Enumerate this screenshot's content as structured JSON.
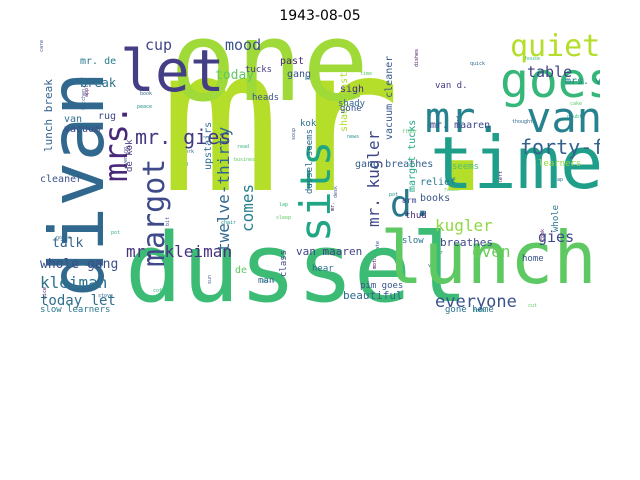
{
  "title": "1943-08-05",
  "words": [
    {
      "text": "mr.",
      "color": "#b5de2b"
    },
    {
      "text": "one",
      "color": "#a0da39"
    },
    {
      "text": "dussel",
      "color": "#3cbb75"
    },
    {
      "text": "lunch",
      "color": "#5ec962"
    },
    {
      "text": "time",
      "color": "#1f9e89"
    },
    {
      "text": "divan",
      "color": "#31688e"
    },
    {
      "text": "let",
      "color": "#433e85"
    },
    {
      "text": "goes",
      "color": "#35b779"
    },
    {
      "text": "mr. van",
      "color": "#26828e"
    },
    {
      "text": "quiet",
      "color": "#b5de2b"
    },
    {
      "text": "sits",
      "color": "#21a685"
    },
    {
      "text": "margot",
      "color": "#3e4a89"
    },
    {
      "text": "mrs.",
      "color": "#482878"
    },
    {
      "text": "d.",
      "color": "#2a788e"
    },
    {
      "text": "everyone",
      "color": "#3b528b"
    },
    {
      "text": "mr. gies",
      "color": "#443983"
    },
    {
      "text": "forty-five",
      "color": "#35608d"
    },
    {
      "text": "mr. kugler",
      "color": "#3f4788"
    },
    {
      "text": "mr. kleiman",
      "color": "#46327e"
    },
    {
      "text": "kleiman",
      "color": "#2c728e"
    },
    {
      "text": "even",
      "color": "#6ccd5a"
    },
    {
      "text": "comes",
      "color": "#277f8e"
    },
    {
      "text": "twelve-thirty",
      "color": "#31688e"
    },
    {
      "text": "kugler",
      "color": "#90d743"
    },
    {
      "text": "gies",
      "color": "#3e4989"
    },
    {
      "text": "table",
      "color": "#424086"
    },
    {
      "text": "mood",
      "color": "#3b528b"
    },
    {
      "text": "cup",
      "color": "#404688"
    },
    {
      "text": "today let",
      "color": "#2e6f8e"
    },
    {
      "text": "whole gang",
      "color": "#3d4e8a"
    },
    {
      "text": "talk",
      "color": "#33638d"
    },
    {
      "text": "today",
      "color": "#5ec962"
    },
    {
      "text": "break",
      "color": "#2c728e"
    },
    {
      "text": "van maaren",
      "color": "#414487"
    },
    {
      "text": "beautiful",
      "color": "#31688e"
    },
    {
      "text": "gang breathes",
      "color": "#355f8d"
    },
    {
      "text": "breathes",
      "color": "#3e4a89"
    },
    {
      "text": "relief",
      "color": "#2a788e"
    },
    {
      "text": "books",
      "color": "#3a548c"
    },
    {
      "text": "lunch break",
      "color": "#33638d"
    },
    {
      "text": "vacuum cleaner",
      "color": "#38588c"
    },
    {
      "text": "shady past",
      "color": "#addc30"
    },
    {
      "text": "margot tucks",
      "color": "#22a884"
    },
    {
      "text": "upstairs",
      "color": "#2f6c8e"
    },
    {
      "text": "mr. maaren",
      "color": "#3f4788"
    },
    {
      "text": "mrs. van",
      "color": "#26828e"
    },
    {
      "text": "seems",
      "color": "#48c16e"
    },
    {
      "text": "gone home",
      "color": "#2d708e"
    },
    {
      "text": "slow learners",
      "color": "#2a788e"
    },
    {
      "text": "mr. de",
      "color": "#287c8e"
    },
    {
      "text": "cleaner",
      "color": "#3b528b"
    },
    {
      "text": "rug",
      "color": "#3e4989"
    },
    {
      "text": "past",
      "color": "#482475"
    },
    {
      "text": "sigh",
      "color": "#472f7d"
    },
    {
      "text": "gone",
      "color": "#3a548c"
    },
    {
      "text": "tucks",
      "color": "#433e85"
    },
    {
      "text": "heads",
      "color": "#3b528b"
    },
    {
      "text": "kok",
      "color": "#2c728e"
    },
    {
      "text": "shady",
      "color": "#31688e"
    },
    {
      "text": "van d.",
      "color": "#443983"
    },
    {
      "text": "class",
      "color": "#3e4a89"
    },
    {
      "text": "hear",
      "color": "#2e6f8e"
    },
    {
      "text": "thud",
      "color": "#482878"
    },
    {
      "text": "man",
      "color": "#31688e"
    },
    {
      "text": "home",
      "color": "#3b528b"
    },
    {
      "text": "slow",
      "color": "#2c728e"
    },
    {
      "text": "arm",
      "color": "#3f4788"
    },
    {
      "text": "de kok",
      "color": "#433e85"
    },
    {
      "text": "whole",
      "color": "#2a788e"
    },
    {
      "text": "learners",
      "color": "#90d743"
    },
    {
      "text": "de",
      "color": "#5ec962"
    },
    {
      "text": "gang",
      "color": "#3b528b"
    },
    {
      "text": "vacuum",
      "color": "#3e4a89"
    },
    {
      "text": "van",
      "color": "#2f6c8e"
    },
    {
      "text": "pim goes",
      "color": "#3a548c"
    },
    {
      "text": "dussel seems",
      "color": "#31688e"
    }
  ],
  "minor_words": [
    "cafe",
    "peace",
    "business",
    "mr.",
    "van",
    "house",
    "kitchen",
    "bed",
    "sleep",
    "mother",
    "quick",
    "doubt",
    "evening",
    "chair",
    "wash",
    "dishes",
    "thought",
    "hand",
    "bit",
    "pile",
    "time",
    "nod",
    "lap",
    "pot",
    "sun",
    "back",
    "floor",
    "left",
    "noise",
    "coffee",
    "nap",
    "news",
    "radio",
    "cook",
    "stove",
    "dry",
    "soup",
    "pot",
    "easy",
    "nice",
    "book",
    "read",
    "desk",
    "door",
    "cut",
    "apple",
    "work",
    "lap",
    "plate",
    "fork",
    "cake",
    "lid"
  ]
}
